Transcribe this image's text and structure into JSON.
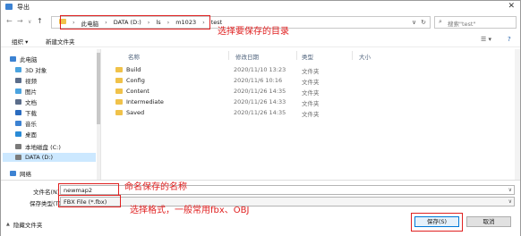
{
  "window": {
    "title": "导出",
    "close": "✕"
  },
  "nav": {
    "back": "←",
    "forward": "→",
    "dropdown": "∨",
    "up": "↑"
  },
  "address": {
    "crumbs": [
      "此电脑",
      "DATA (D:)",
      "ls",
      "m1023",
      "test"
    ],
    "separator": "›",
    "dropdown": "∨",
    "refresh": "↻"
  },
  "search": {
    "icon": "⌕",
    "placeholder": "搜索\"test\""
  },
  "annotations": {
    "dir": "选择要保存的目录",
    "name": "命名保存的名称",
    "format": "选择格式，一般常用fbx、OBJ"
  },
  "toolbar": {
    "organize": "组织 ▾",
    "new_folder": "新建文件夹",
    "view": "☰ ▾",
    "help": "?"
  },
  "sidebar": {
    "items": [
      {
        "label": "此电脑",
        "color": "#3c82d2"
      },
      {
        "label": "3D 对象",
        "color": "#4aa3df"
      },
      {
        "label": "视频",
        "color": "#5b6d8a"
      },
      {
        "label": "图片",
        "color": "#4aa3df"
      },
      {
        "label": "文档",
        "color": "#5b6d8a"
      },
      {
        "label": "下载",
        "color": "#2a6bbf"
      },
      {
        "label": "音乐",
        "color": "#3c82d2"
      },
      {
        "label": "桌面",
        "color": "#2a8bd6"
      },
      {
        "label": "本地磁盘 (C:)",
        "color": "#7a7a7a"
      },
      {
        "label": "DATA (D:)",
        "color": "#7a7a7a"
      },
      {
        "label": "网络",
        "color": "#3c82d2"
      }
    ]
  },
  "files": {
    "columns": {
      "name": "名称",
      "modified": "修改日期",
      "type": "类型",
      "size": "大小"
    },
    "rows": [
      {
        "name": "Build",
        "modified": "2020/11/10 13:23",
        "type": "文件夹"
      },
      {
        "name": "Config",
        "modified": "2020/11/6 10:16",
        "type": "文件夹"
      },
      {
        "name": "Content",
        "modified": "2020/11/26 14:35",
        "type": "文件夹"
      },
      {
        "name": "Intermediate",
        "modified": "2020/11/26 14:33",
        "type": "文件夹"
      },
      {
        "name": "Saved",
        "modified": "2020/11/26 14:35",
        "type": "文件夹"
      }
    ]
  },
  "save": {
    "filename_label": "文件名(N):",
    "filename_value": "newmap2",
    "type_label": "保存类型(T):",
    "type_value": "FBX File (*.fbx)",
    "dropdown": "∨"
  },
  "footer": {
    "hide_folders": "隐藏文件夹",
    "hide_icon": "▲",
    "save_button": "保存(S)",
    "cancel_button": "取消"
  }
}
